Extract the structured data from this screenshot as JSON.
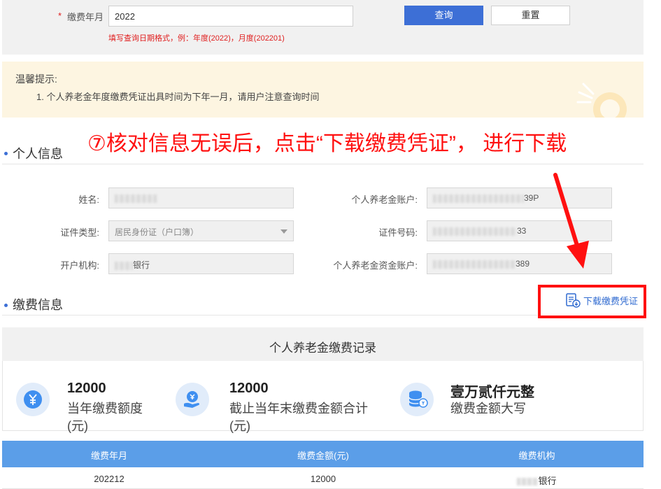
{
  "query": {
    "label": "缴费年月",
    "value": "2022",
    "hint": "填写查询日期格式，例：年度(2022)，月度(202201)",
    "query_button": "查询",
    "reset_button": "重置"
  },
  "tip": {
    "title": "温馨提示:",
    "line1": "1. 个人养老金年度缴费凭证出具时间为下年一月，请用户注意查询时间"
  },
  "annotation": "⑦核对信息无误后，点击“下载缴费凭证”， 进行下载",
  "personal": {
    "section_title": "个人信息",
    "name_label": "姓名:",
    "name_value": "",
    "account_label": "个人养老金账户:",
    "account_suffix": "39P",
    "id_type_label": "证件类型:",
    "id_type_value": "居民身份证（户口簿）",
    "id_number_label": "证件号码:",
    "id_number_suffix": "33",
    "bank_label": "开户机构:",
    "bank_value": "银行",
    "fund_account_label": "个人养老金资金账户:",
    "fund_account_suffix": "389"
  },
  "payment": {
    "section_title": "缴费信息",
    "download_link": "下载缴费凭证",
    "record_title": "个人养老金缴费记录",
    "stats": [
      {
        "value": "12000",
        "caption_line1": "当年缴费额度",
        "caption_line2": "(元)",
        "icon": "yen-icon"
      },
      {
        "value": "12000",
        "caption_line1": "截止当年末缴费金额合计",
        "caption_line2": "(元)",
        "icon": "hand-coin-icon"
      },
      {
        "value": "壹万贰仟元整",
        "caption_line1": "缴费金额大写",
        "caption_line2": "",
        "icon": "coin-stack-icon"
      }
    ],
    "table": {
      "headers": [
        "缴费年月",
        "缴费金额(元)",
        "缴费机构"
      ],
      "rows": [
        [
          "202212",
          "12000",
          "银行"
        ]
      ]
    }
  },
  "colors": {
    "primary": "#3d6fd6",
    "table_header": "#5b9ee8",
    "annotation_red": "#ff1010",
    "tip_bg": "#fdf5e1"
  }
}
